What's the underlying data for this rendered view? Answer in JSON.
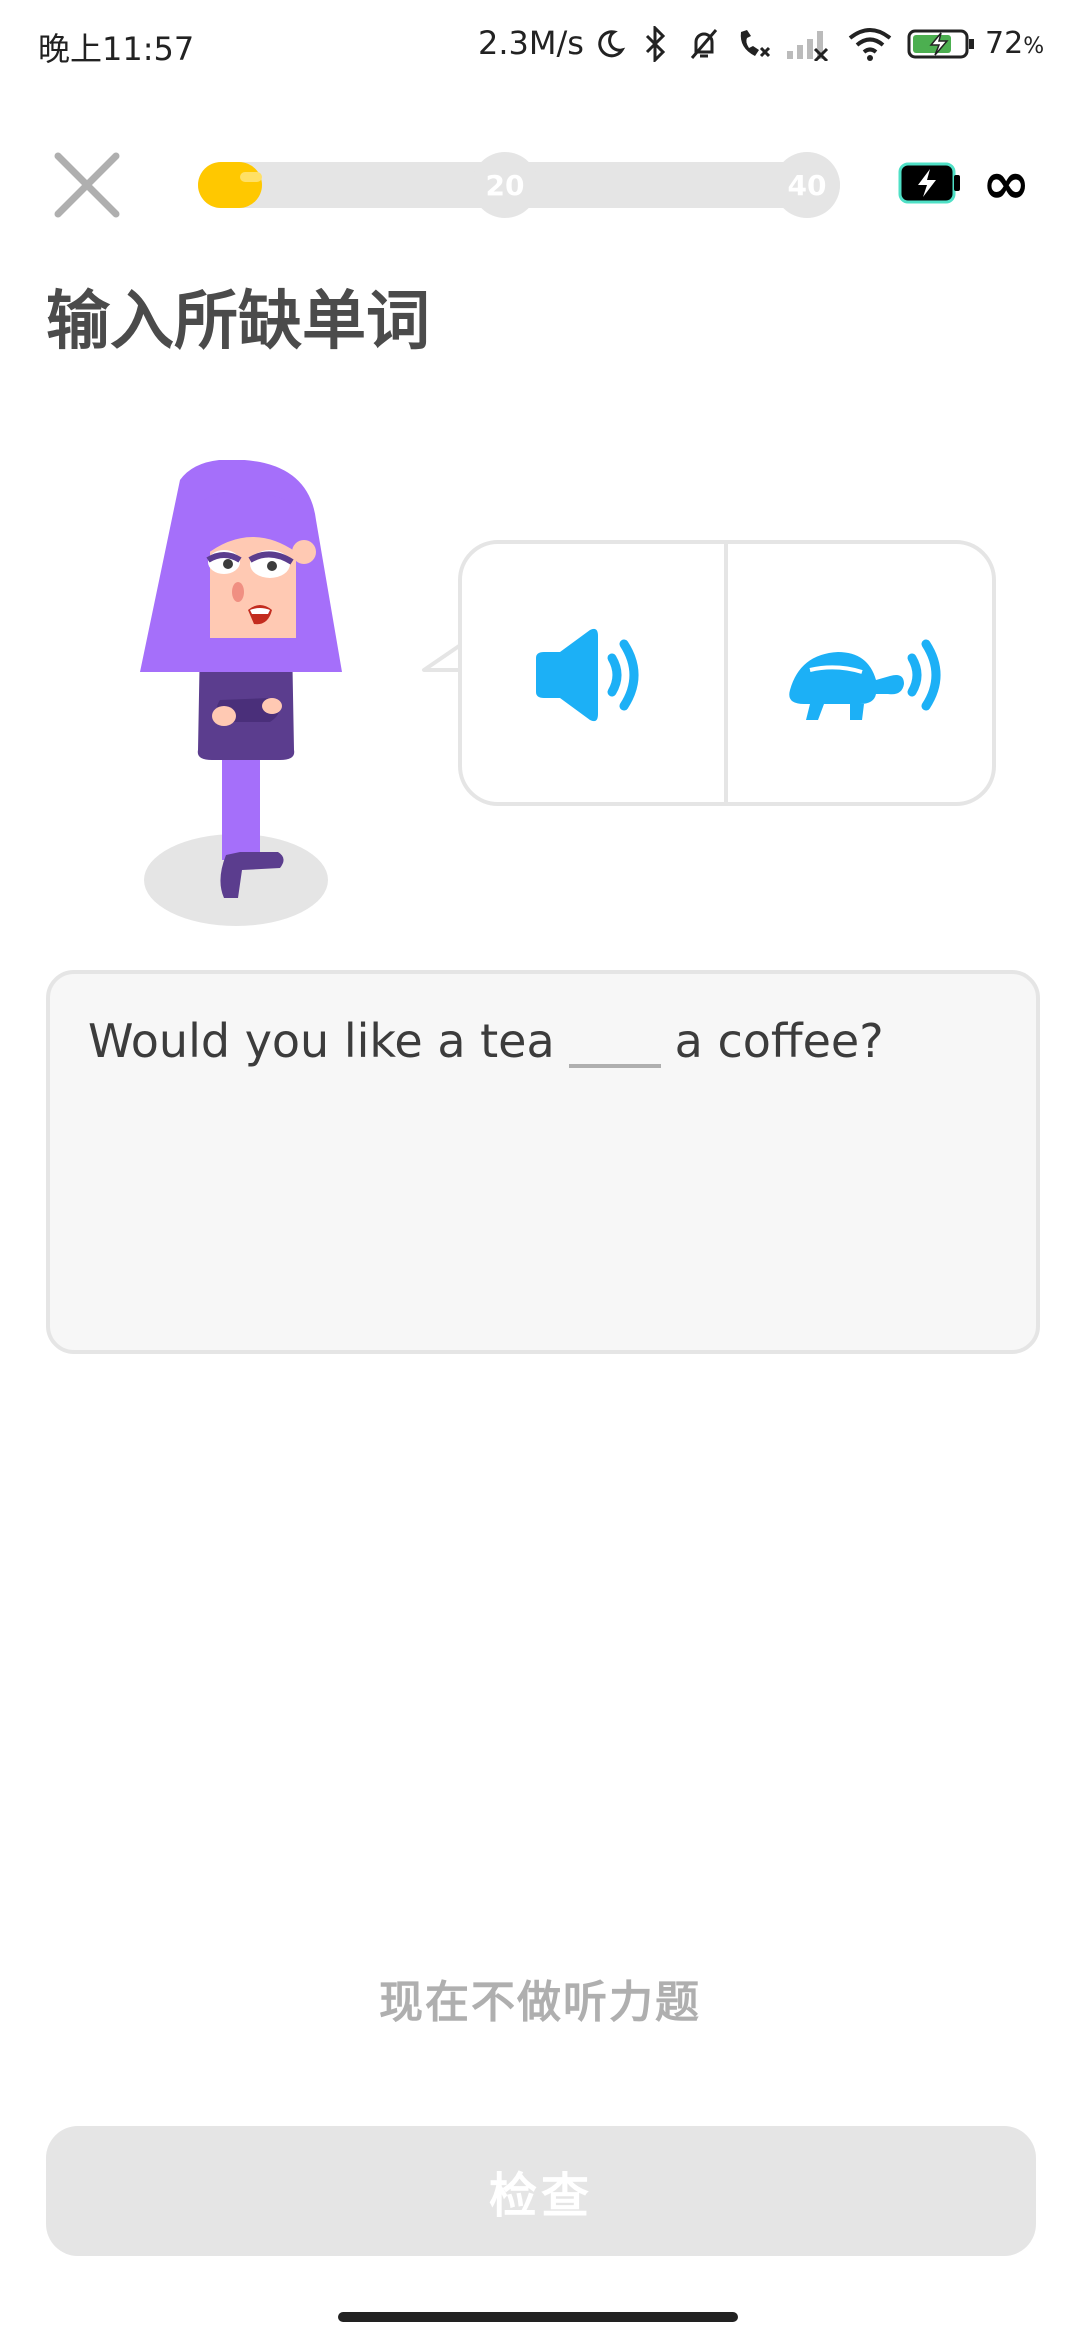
{
  "status_bar": {
    "time": "晚上11:57",
    "network_speed": "2.3M/s",
    "battery_percent": "72",
    "icons": [
      "moon-icon",
      "bluetooth-icon",
      "bell-muted-icon",
      "call-icon",
      "signal-icon",
      "wifi-icon",
      "battery-charging-icon"
    ]
  },
  "lesson": {
    "progress_value": 0.1,
    "milestones": [
      "20",
      "40"
    ],
    "infinity_label": "∞",
    "colors": {
      "progress": "#ffc800",
      "accent_blue": "#1cb0f6",
      "character_purple": "#a56ffa"
    }
  },
  "prompt": {
    "title": "输入所缺单词"
  },
  "sentence": {
    "before": "Would you like a tea",
    "after": "a coffee?",
    "answer_value": ""
  },
  "actions": {
    "skip_listening": "现在不做听力题",
    "check": "检查"
  }
}
